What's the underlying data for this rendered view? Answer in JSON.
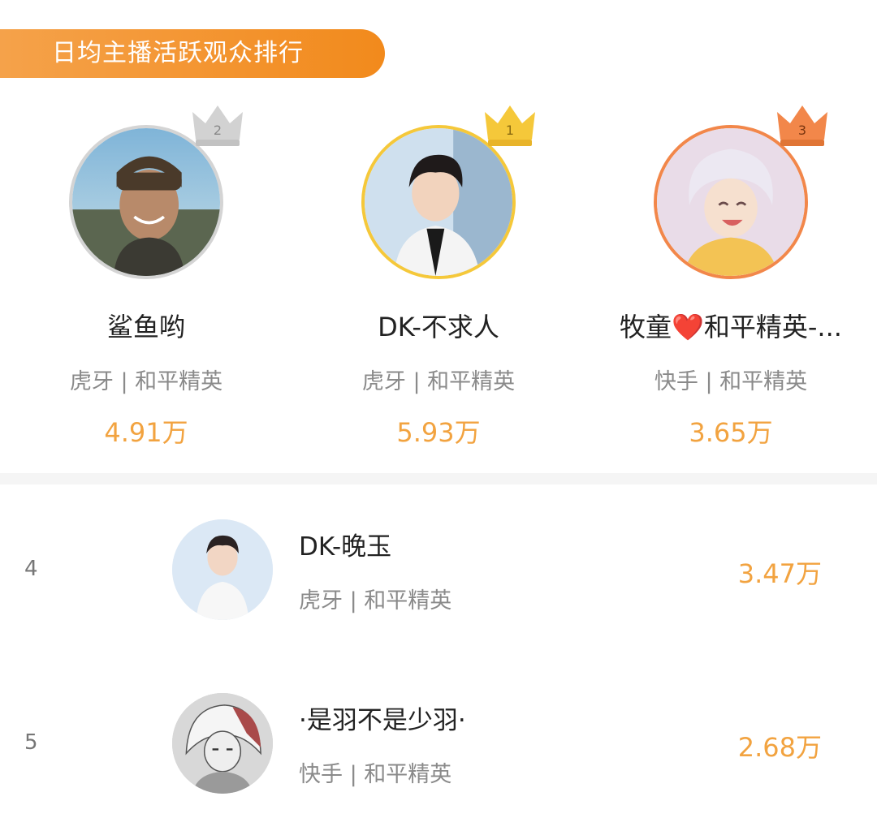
{
  "header": {
    "title": "日均主播活跃观众排行"
  },
  "podium": [
    {
      "rank": "2",
      "name": "鲨鱼哟",
      "platform_line": "虎牙 | 和平精英",
      "value": "4.91万",
      "crown_color": "#cfcfcf"
    },
    {
      "rank": "1",
      "name": "DK-不求人",
      "platform_line": "虎牙 | 和平精英",
      "value": "5.93万",
      "crown_color": "#f5c83a"
    },
    {
      "rank": "3",
      "name": "牧童❤️和平精英-...",
      "platform_line": "快手 | 和平精英",
      "value": "3.65万",
      "crown_color": "#f2874a"
    }
  ],
  "list": [
    {
      "rank": "4",
      "name": "DK-晚玉",
      "platform_line": "虎牙 | 和平精英",
      "value": "3.47万"
    },
    {
      "rank": "5",
      "name": "·是羽不是少羽·",
      "platform_line": "快手 | 和平精英",
      "value": "2.68万"
    }
  ],
  "colors": {
    "accent": "#f28a1c",
    "value_text": "#f2a340",
    "gold": "#f5c83a",
    "silver": "#cfcfcf",
    "bronze": "#f2874a"
  }
}
